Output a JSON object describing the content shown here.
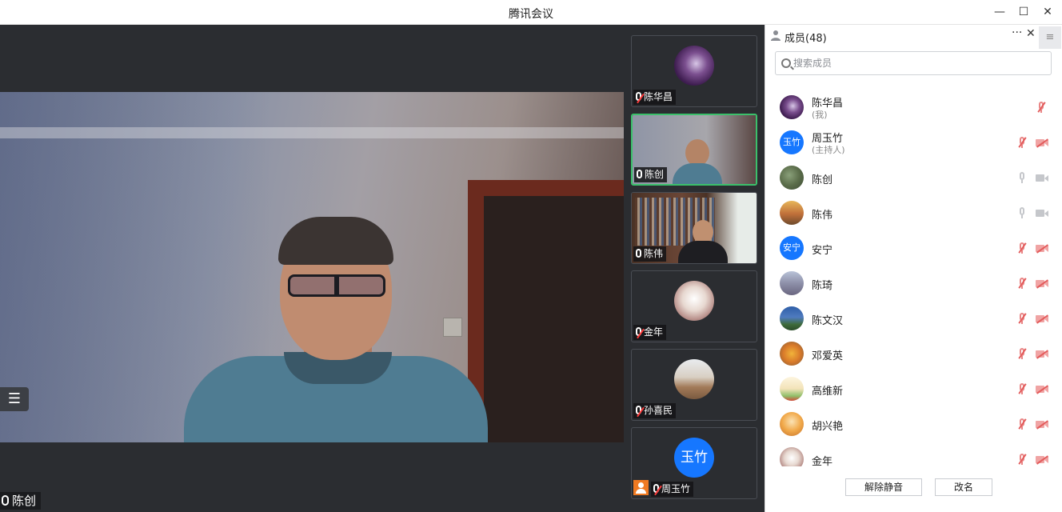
{
  "window": {
    "title": "腾讯会议",
    "min": "—",
    "max": "☐",
    "close": "✕"
  },
  "main": {
    "speaker_name": "陈创",
    "list_icon": "☰"
  },
  "tiles": [
    {
      "name": "陈华昌",
      "muted": true
    },
    {
      "name": "陈创",
      "muted": false
    },
    {
      "name": "陈伟",
      "muted": false
    },
    {
      "name": "金年",
      "muted": true
    },
    {
      "name": "孙喜民",
      "muted": true
    },
    {
      "name": "周玉竹",
      "muted": true,
      "avatar_text": "玉竹"
    }
  ],
  "panel": {
    "title": "成员(48)",
    "more": "···",
    "close": "✕",
    "menu": "≡",
    "search_placeholder": "搜索成员",
    "members": [
      {
        "name": "陈华昌",
        "sub": "(我)"
      },
      {
        "name": "周玉竹",
        "sub": "(主持人)",
        "avatar_text": "玉竹"
      },
      {
        "name": "陈创",
        "sub": ""
      },
      {
        "name": "陈伟",
        "sub": ""
      },
      {
        "name": "安宁",
        "sub": "",
        "avatar_text": "安宁"
      },
      {
        "name": "陈琦",
        "sub": ""
      },
      {
        "name": "陈文汉",
        "sub": ""
      },
      {
        "name": "邓爱英",
        "sub": ""
      },
      {
        "name": "高维新",
        "sub": ""
      },
      {
        "name": "胡兴艳",
        "sub": ""
      },
      {
        "name": "金年",
        "sub": ""
      }
    ],
    "buttons": {
      "unmute_all": "解除静音",
      "rename": "改名"
    }
  },
  "colors": {
    "accent_blue": "#1677ff",
    "active_green": "#3bc06b",
    "mute_red": "#e35d5d"
  }
}
